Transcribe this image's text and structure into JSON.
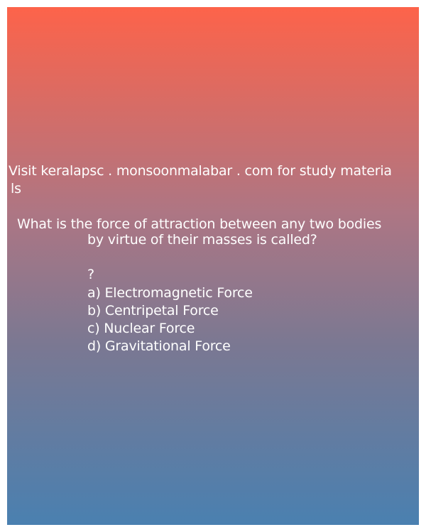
{
  "promo": {
    "line1": "Visit keralapsc . monsoonmalabar . com for study materia",
    "line2": "ls"
  },
  "question": {
    "line1": "What is the force of attraction between any two bodies",
    "line2": "by virtue of their masses is called?",
    "mark": "?"
  },
  "options": {
    "a": "a) Electromagnetic Force",
    "b": "b) Centripetal Force",
    "c": "c) Nuclear Force",
    "d": "d) Gravitational Force"
  },
  "colors": {
    "gradient_top": "#fd634a",
    "gradient_bottom": "#4a80b0",
    "text": "#ffffff"
  }
}
